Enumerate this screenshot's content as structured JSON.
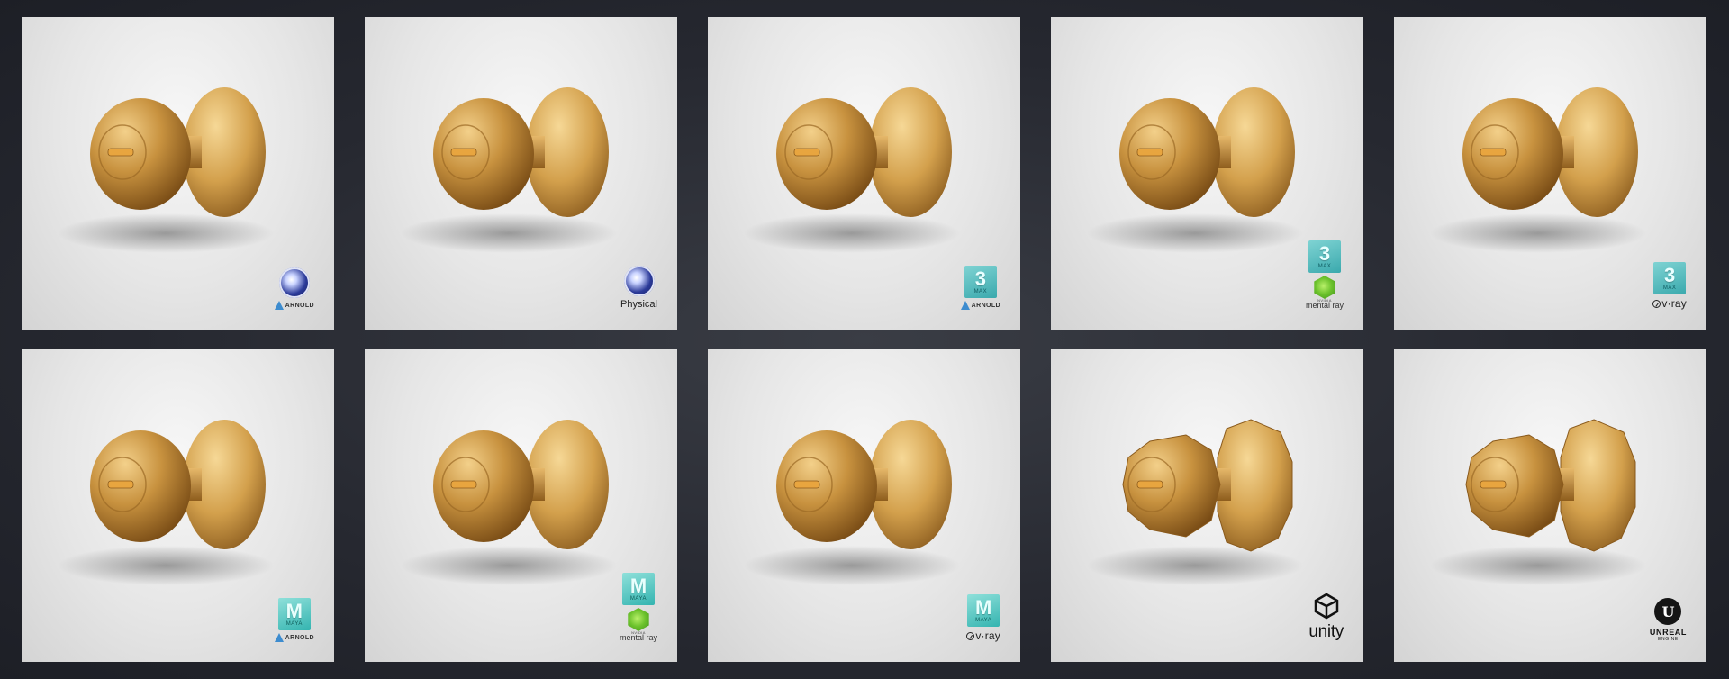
{
  "tiles": [
    {
      "id": "tile-c4d-arnold",
      "knob": "smooth",
      "badges": [
        {
          "type": "c4d-icon"
        },
        {
          "type": "arnold",
          "label": "ARNOLD"
        }
      ]
    },
    {
      "id": "tile-c4d-physical",
      "knob": "smooth",
      "badges": [
        {
          "type": "c4d-icon"
        },
        {
          "type": "text",
          "label": "Physical"
        }
      ]
    },
    {
      "id": "tile-3dsmax-arnold",
      "knob": "smooth",
      "badges": [
        {
          "type": "3dsmax-icon",
          "big": "3",
          "small": "MAX"
        },
        {
          "type": "arnold",
          "label": "ARNOLD"
        }
      ]
    },
    {
      "id": "tile-3dsmax-mentalray",
      "knob": "smooth",
      "badges": [
        {
          "type": "3dsmax-icon",
          "big": "3",
          "small": "MAX"
        },
        {
          "type": "mentalray",
          "small": "NVIDIA",
          "label": "mental ray"
        }
      ]
    },
    {
      "id": "tile-3dsmax-vray",
      "knob": "smooth",
      "badges": [
        {
          "type": "3dsmax-icon",
          "big": "3",
          "small": "MAX"
        },
        {
          "type": "vray",
          "label": "v·ray"
        }
      ]
    },
    {
      "id": "tile-maya-arnold",
      "knob": "smooth",
      "badges": [
        {
          "type": "maya-icon",
          "big": "M",
          "small": "MAYA"
        },
        {
          "type": "arnold",
          "label": "ARNOLD"
        }
      ]
    },
    {
      "id": "tile-maya-mentalray",
      "knob": "smooth",
      "badges": [
        {
          "type": "maya-icon",
          "big": "M",
          "small": "MAYA"
        },
        {
          "type": "mentalray",
          "small": "NVIDIA",
          "label": "mental ray"
        }
      ]
    },
    {
      "id": "tile-maya-vray",
      "knob": "smooth",
      "badges": [
        {
          "type": "maya-icon",
          "big": "M",
          "small": "MAYA"
        },
        {
          "type": "vray",
          "label": "v·ray"
        }
      ]
    },
    {
      "id": "tile-unity",
      "knob": "lowpoly",
      "badges": [
        {
          "type": "unity-icon"
        },
        {
          "type": "text-unity",
          "label": "unity"
        }
      ]
    },
    {
      "id": "tile-unreal",
      "knob": "lowpoly",
      "badges": [
        {
          "type": "ue-icon",
          "big": "U",
          "label": "UNREAL",
          "small": "ENGINE"
        }
      ]
    }
  ],
  "colors": {
    "gold_light": "#f3d08a",
    "gold_mid": "#c8923f",
    "gold_dark": "#6f4310",
    "background": "#2b2d35",
    "tile": "#ececec"
  }
}
